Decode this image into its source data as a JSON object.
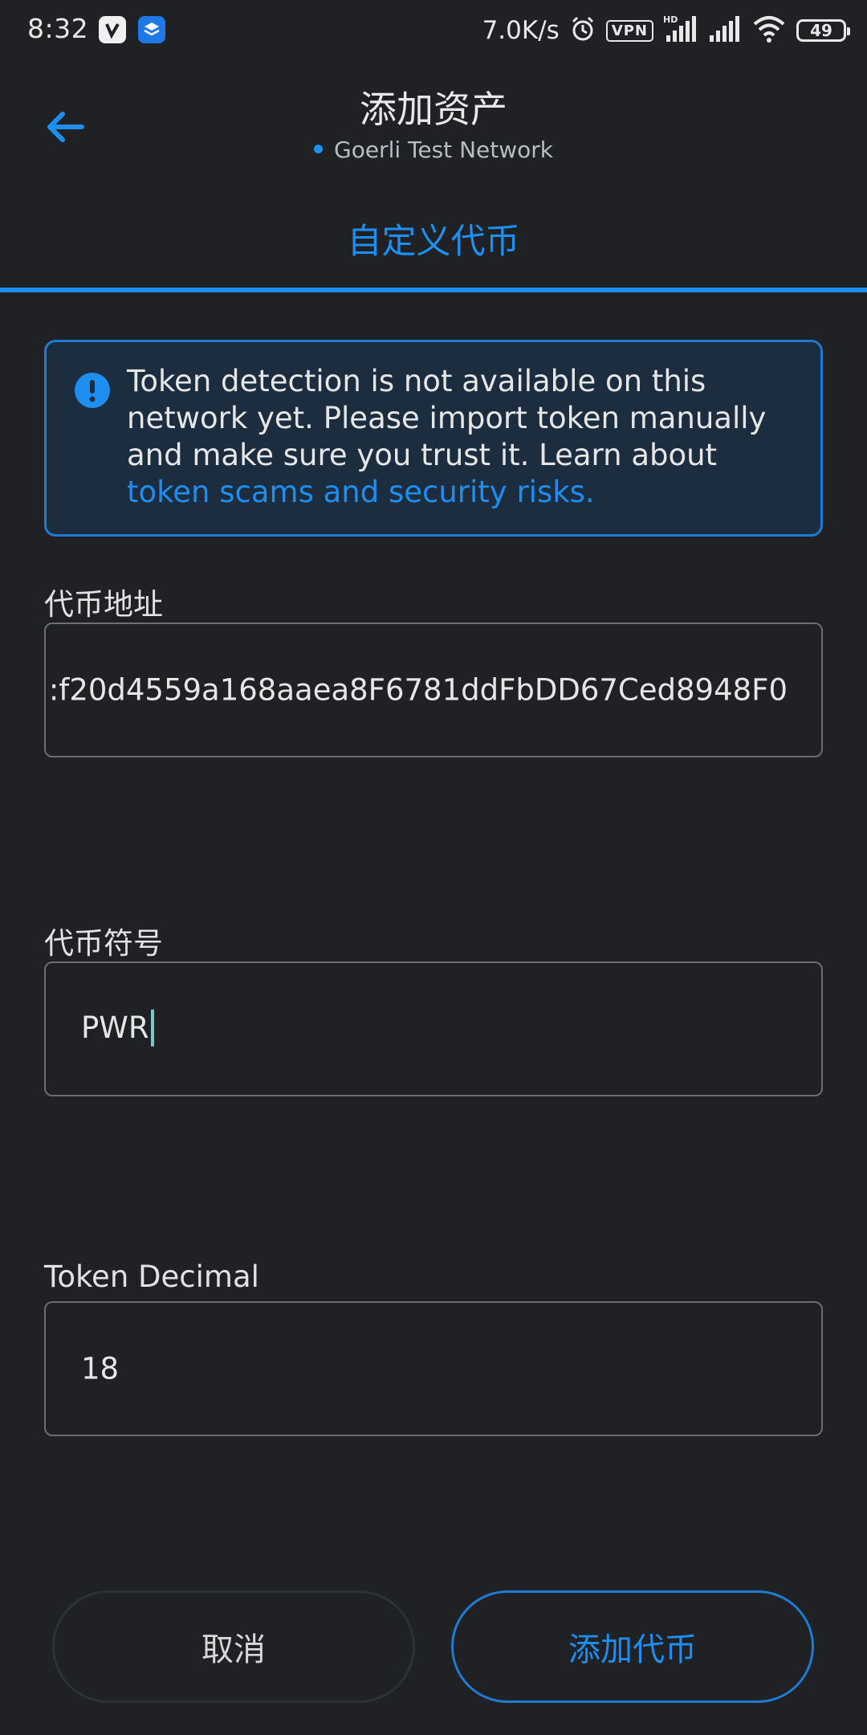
{
  "status_bar": {
    "time": "8:32",
    "net_speed": "7.0K/s",
    "vpn": "VPN",
    "hd": "HD",
    "battery": "49"
  },
  "header": {
    "title": "添加资产",
    "network": "Goerli Test Network"
  },
  "tab": {
    "label": "自定义代币"
  },
  "alert": {
    "text": "Token detection is not available on this network yet. Please import token manually and make sure you trust it. Learn about ",
    "link": "token scams and security risks."
  },
  "fields": {
    "address_label": "代币地址",
    "address_value": ":f20d4559a168aaea8F6781ddFbDD67Ced8948F0",
    "symbol_label": "代币符号",
    "symbol_value": "PWR",
    "decimal_label": "Token Decimal",
    "decimal_value": "18"
  },
  "buttons": {
    "cancel": "取消",
    "add": "添加代币"
  },
  "colors": {
    "accent": "#1f8ef1",
    "background": "#1f2124",
    "alert_bg": "#1b2d3e"
  }
}
